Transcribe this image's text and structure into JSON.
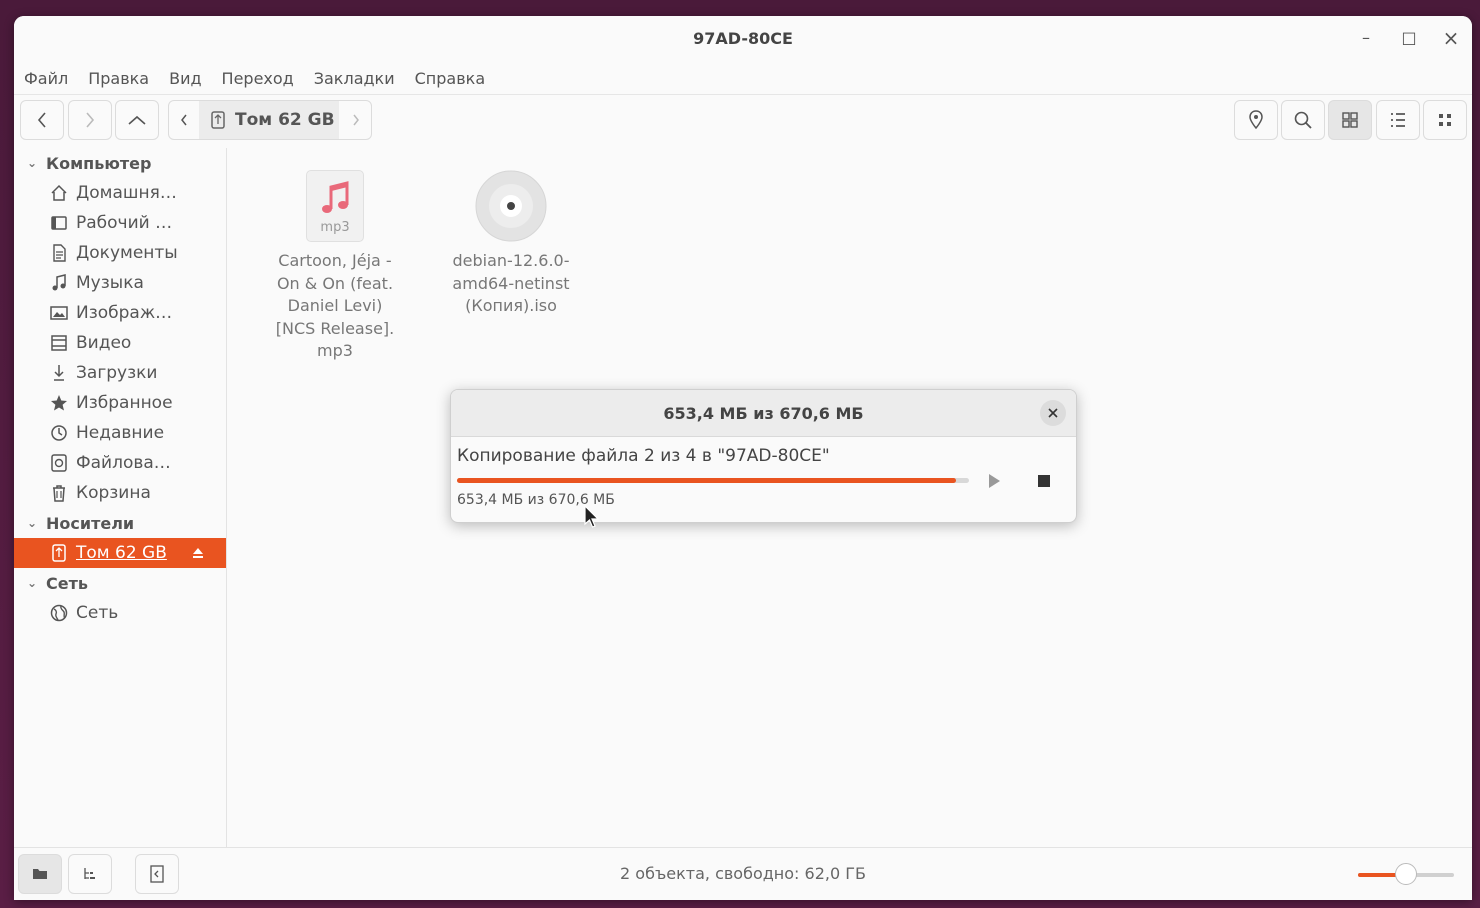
{
  "window": {
    "title": "97AD-80CE",
    "controls": {
      "minimize": "–",
      "maximize": "□",
      "close": "×"
    }
  },
  "menu": [
    "Файл",
    "Правка",
    "Вид",
    "Переход",
    "Закладки",
    "Справка"
  ],
  "toolbar": {
    "path_segment": "Том 62 GB"
  },
  "sidebar": {
    "sections": [
      {
        "header": "Компьютер",
        "items": [
          {
            "label": "Домашня…",
            "icon": "home-icon"
          },
          {
            "label": "Рабочий …",
            "icon": "desktop-icon"
          },
          {
            "label": "Документы",
            "icon": "document-icon"
          },
          {
            "label": "Музыка",
            "icon": "music-icon"
          },
          {
            "label": "Изображ…",
            "icon": "image-icon"
          },
          {
            "label": "Видео",
            "icon": "video-icon"
          },
          {
            "label": "Загрузки",
            "icon": "download-icon"
          },
          {
            "label": "Избранное",
            "icon": "star-icon"
          },
          {
            "label": "Недавние",
            "icon": "clock-icon"
          },
          {
            "label": "Файлова…",
            "icon": "filesystem-icon"
          },
          {
            "label": "Корзина",
            "icon": "trash-icon"
          }
        ]
      },
      {
        "header": "Носители",
        "items": [
          {
            "label": "Том 62 GB",
            "icon": "usb-drive-icon",
            "active": true
          }
        ]
      },
      {
        "header": "Сеть",
        "items": [
          {
            "label": "Сеть",
            "icon": "network-icon"
          }
        ]
      }
    ]
  },
  "files": [
    {
      "name_lines": [
        "Cartoon, Jéja -",
        "On & On (feat.",
        "Daniel Levi)",
        "[NCS Release].",
        "mp3"
      ],
      "icon": "audio-file-icon",
      "icon_label": "mp3"
    },
    {
      "name_lines": [
        "debian-12.6.0-",
        "amd64-netinst",
        "(Копия).iso"
      ],
      "icon": "disc-image-icon"
    }
  ],
  "dialog": {
    "title": "653,4 МБ из 670,6 МБ",
    "message": "Копирование файла 2 из 4 в \"97AD-80CE\"",
    "detail": "653,4 МБ из 670,6 МБ",
    "progress": 0.974
  },
  "status": {
    "text": "2 объекта, свободно: 62,0 ГБ",
    "zoom_level": 0.5
  },
  "colors": {
    "accent": "#e95420"
  }
}
